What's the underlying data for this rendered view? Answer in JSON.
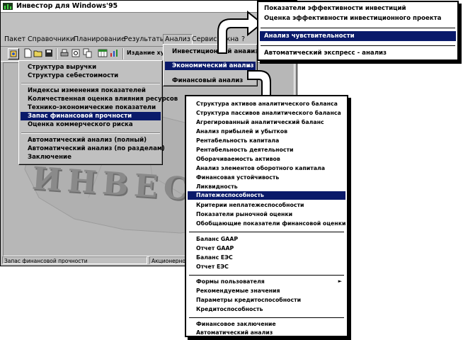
{
  "window": {
    "title": "Инвестор для Windows'95"
  },
  "menubar": {
    "items": [
      "Пакет",
      "Справочники",
      "Планирование",
      "Результаты",
      "Анализ",
      "Сервис",
      "Окна",
      "?"
    ]
  },
  "toolbar": {
    "label": "Издание худ"
  },
  "watermark": "ИНВЕСТОР",
  "status": {
    "left": "Запас финансовой прочности",
    "right": "Акционерное об"
  },
  "analysis_menu": {
    "items": [
      {
        "label": "Инвестиционный анализ",
        "submenu": true
      },
      {
        "label": "Экономический анализ",
        "submenu": true
      },
      {
        "label": "Финансовый анализ",
        "submenu": true
      }
    ]
  },
  "economic_menu": {
    "group1": [
      "Структура выручки",
      "Структура себестоимости"
    ],
    "group2": [
      "Индексы изменения показателей",
      "Количественная оценка влияния ресурсов",
      "Технико-экономические показатели",
      "Запас финансовой прочности",
      "Оценка коммерческого риска"
    ],
    "group3": [
      "Автоматический анализ (полный)",
      "Автоматический анализ (по разделам)",
      "Заключение"
    ],
    "highlighted": "Запас финансовой прочности"
  },
  "investment_callout": {
    "items": [
      "Показатели эффективности инвестиций",
      "Оценка эффективности инвестиционного проекта",
      "Анализ чувствительности",
      "Автоматический экспресс - анализ"
    ],
    "highlighted": "Анализ чувствительности"
  },
  "financial_callout": {
    "group1": [
      "Структура активов аналитического баланса",
      "Структура пассивов аналитического баланса",
      "Агрегированный аналитический баланс",
      "Анализ прибылей и убытков",
      "Рентабельность капитала",
      "Рентабельность деятельности",
      "Оборачиваемость активов",
      "Анализ элементов оборотного капитала",
      "Финансовая устойчивость",
      "Ликвидность",
      "Платежеспособность",
      "Критерии неплатежеспособности",
      "Показатели рыночной оценки",
      "Обобщающие показатели финансовой оценки"
    ],
    "group2": [
      "Баланс GAAP",
      "Отчет GAAP",
      "Баланс ЕЭС",
      "Отчет ЕЭС"
    ],
    "group3": [
      "Формы пользователя",
      "Рекомендуемые значения",
      "Параметры кредитоспособности",
      "Кредитоспособность"
    ],
    "group4": [
      "Финансовое заключение",
      "Автоматический анализ"
    ],
    "highlighted": "Платежеспособность"
  }
}
